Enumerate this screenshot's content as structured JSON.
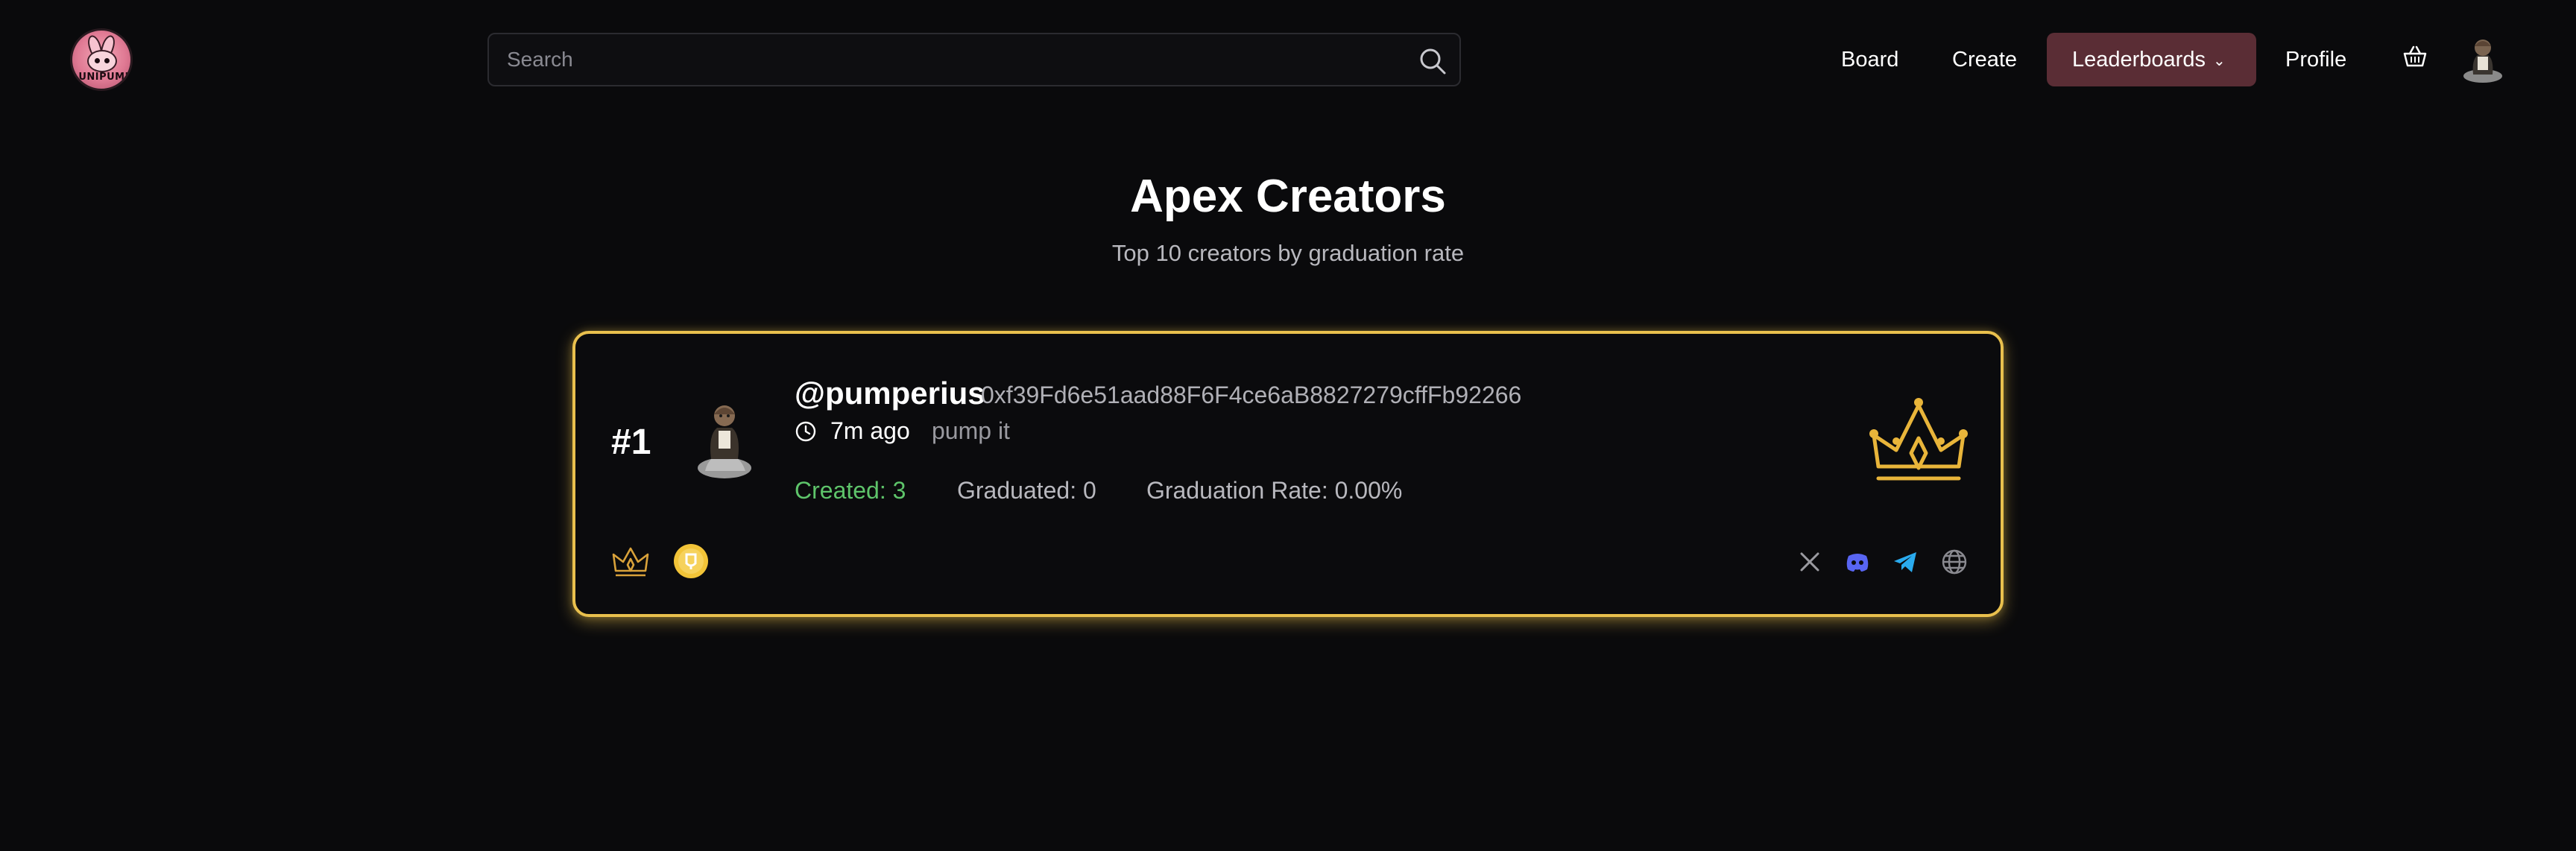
{
  "header": {
    "logo_text": "LUNIPUMP",
    "search": {
      "placeholder": "Search",
      "value": ""
    },
    "nav": {
      "board": "Board",
      "create": "Create",
      "leaderboards": "Leaderboards",
      "profile": "Profile"
    },
    "icons": [
      "search-icon",
      "chevron-down-icon",
      "basket-icon",
      "avatar"
    ]
  },
  "main": {
    "title": "Apex Creators",
    "subtitle": "Top 10 creators by graduation rate"
  },
  "entries": [
    {
      "rank": "#1",
      "handle": "@pumperius",
      "address": "0xf39Fd6e51aad88F6F4ce6aB8827279cffFb92266",
      "time_ago": "7m ago",
      "tagline": "pump it",
      "created": "Created: 3",
      "graduated": "Graduated: 0",
      "graduation_rate": "Graduation Rate: 0.00%",
      "icons": [
        "crown-icon",
        "small-crown-icon",
        "coin-badge-icon",
        "x-icon",
        "discord-icon",
        "telegram-icon",
        "globe-icon"
      ]
    }
  ],
  "colors": {
    "background": "#0a0a0c",
    "accent_gold": "#e9c04d",
    "leaderboards_bg": "#5a2d35",
    "created_green": "#5ec46a",
    "discord": "#5865f2",
    "telegram": "#2aabee"
  }
}
